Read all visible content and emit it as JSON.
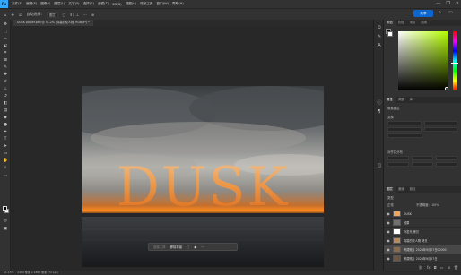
{
  "app": {
    "logo": "Ps"
  },
  "menu": [
    "文件(F)",
    "编辑(E)",
    "图像(I)",
    "图层(L)",
    "文字(Y)",
    "选择(S)",
    "滤镜(T)",
    "3D(D)",
    "视图(V)",
    "增效工具",
    "窗口(W)",
    "帮助(H)"
  ],
  "window_controls": [
    "—",
    "❐",
    "✕"
  ],
  "options_bar": {
    "home_icon": "home-icon",
    "tool_icon": "move-tool-icon",
    "auto_select_label": "自动选择:",
    "auto_select_value": "图层",
    "share_label": "共享"
  },
  "document": {
    "tab_title": "DUSK poster.psd @ 51.2% (向暮的双人物, RGB/8*) *"
  },
  "canvas": {
    "headline": "DUSK",
    "accent_colors": {
      "sky_glow": "#ff8a1e",
      "text_orange": "#f39540"
    }
  },
  "context_bar": {
    "select_subject": "选择主体",
    "remove_bg": "移除背景"
  },
  "statusbar": {
    "zoom": "51.15%",
    "doc_info": "2480 像素 x 1860 像素 (72 ppi)"
  },
  "panels": {
    "color_tabs": [
      "颜色",
      "色板",
      "渐变",
      "图案"
    ],
    "properties_tabs": [
      "属性",
      "调整",
      "库"
    ],
    "properties_subtitle": "像素图层",
    "transform_label": "变换",
    "align_label": "对齐并分布",
    "layer_tabs": [
      "图层",
      "通道",
      "路径"
    ],
    "layer_kind": "类型",
    "layer_mode": "正常",
    "layer_opacity_label": "不透明度: 100%",
    "layers": [
      {
        "name": "DUSK",
        "thumb": "#f0a560",
        "selected": false
      },
      {
        "name": "效果",
        "thumb": "#707070",
        "selected": false
      },
      {
        "name": "外发光 拷贝",
        "thumb": "#ffffff",
        "selected": false
      },
      {
        "name": "向暮的双人物 拷贝",
        "thumb": "#b58a5f",
        "selected": false
      },
      {
        "name": "黄昏照片 2024年9月27日00000",
        "thumb": "#8a6b4c",
        "selected": true
      },
      {
        "name": "黄昏照片 2024年9月27日",
        "thumb": "#6a5442",
        "selected": false
      },
      {
        "name": "图层 4 拷贝 2",
        "thumb": "#9a6a45",
        "selected": false
      },
      {
        "name": "图层 4 拷贝",
        "thumb": "#7b5a40",
        "selected": false
      }
    ]
  }
}
